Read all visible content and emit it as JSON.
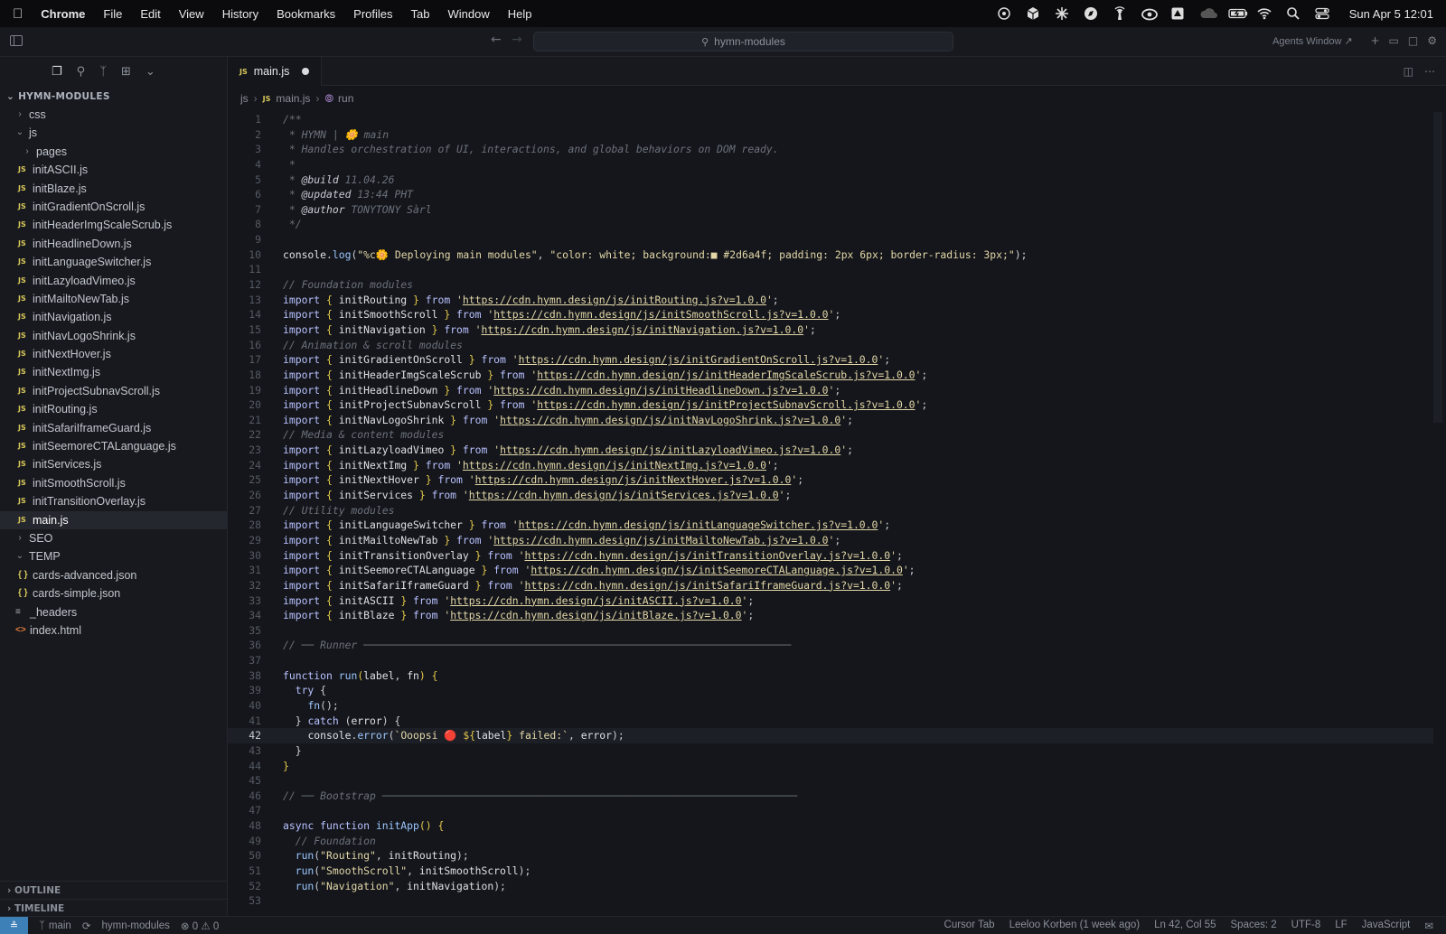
{
  "menubar": {
    "app": "Chrome",
    "items": [
      "File",
      "Edit",
      "View",
      "History",
      "Bookmarks",
      "Profiles",
      "Tab",
      "Window",
      "Help"
    ],
    "clock": "Sun Apr 5  12:01"
  },
  "titlebar": {
    "search_text": "hymn-modules",
    "agents_label": "Agents Window ↗"
  },
  "sidebar": {
    "root": "HYMN-MODULES",
    "tree": [
      {
        "label": "css",
        "kind": "folder",
        "open": false,
        "depth": 0
      },
      {
        "label": "js",
        "kind": "folder",
        "open": true,
        "depth": 0
      },
      {
        "label": "pages",
        "kind": "folder",
        "open": false,
        "depth": 1
      },
      {
        "label": "initASCII.js",
        "kind": "js",
        "depth": 1
      },
      {
        "label": "initBlaze.js",
        "kind": "js",
        "depth": 1
      },
      {
        "label": "initGradientOnScroll.js",
        "kind": "js",
        "depth": 1
      },
      {
        "label": "initHeaderImgScaleScrub.js",
        "kind": "js",
        "depth": 1
      },
      {
        "label": "initHeadlineDown.js",
        "kind": "js",
        "depth": 1
      },
      {
        "label": "initLanguageSwitcher.js",
        "kind": "js",
        "depth": 1
      },
      {
        "label": "initLazyloadVimeo.js",
        "kind": "js",
        "depth": 1
      },
      {
        "label": "initMailtoNewTab.js",
        "kind": "js",
        "depth": 1
      },
      {
        "label": "initNavigation.js",
        "kind": "js",
        "depth": 1
      },
      {
        "label": "initNavLogoShrink.js",
        "kind": "js",
        "depth": 1
      },
      {
        "label": "initNextHover.js",
        "kind": "js",
        "depth": 1
      },
      {
        "label": "initNextImg.js",
        "kind": "js",
        "depth": 1
      },
      {
        "label": "initProjectSubnavScroll.js",
        "kind": "js",
        "depth": 1
      },
      {
        "label": "initRouting.js",
        "kind": "js",
        "depth": 1
      },
      {
        "label": "initSafariIframeGuard.js",
        "kind": "js",
        "depth": 1
      },
      {
        "label": "initSeemoreCTALanguage.js",
        "kind": "js",
        "depth": 1
      },
      {
        "label": "initServices.js",
        "kind": "js",
        "depth": 1
      },
      {
        "label": "initSmoothScroll.js",
        "kind": "js",
        "depth": 1
      },
      {
        "label": "initTransitionOverlay.js",
        "kind": "js",
        "depth": 1
      },
      {
        "label": "main.js",
        "kind": "js",
        "depth": 1,
        "active": true
      },
      {
        "label": "SEO",
        "kind": "folder",
        "open": false,
        "depth": 0
      },
      {
        "label": "TEMP",
        "kind": "folder",
        "open": true,
        "depth": 0
      },
      {
        "label": "cards-advanced.json",
        "kind": "json",
        "depth": 1
      },
      {
        "label": "cards-simple.json",
        "kind": "json",
        "depth": 1
      },
      {
        "label": "_headers",
        "kind": "list",
        "depth": 0
      },
      {
        "label": "index.html",
        "kind": "html",
        "depth": 0
      }
    ],
    "outline": "OUTLINE",
    "timeline": "TIMELINE"
  },
  "tab": {
    "label": "main.js",
    "badge": "JS"
  },
  "breadcrumb": {
    "folder": "js",
    "file": "main.js",
    "symbol": "run"
  },
  "code": {
    "current_line": 42,
    "lines": [
      [
        [
          "c",
          "/**"
        ]
      ],
      [
        [
          "c",
          " * HYMN | 🌼 main"
        ]
      ],
      [
        [
          "c",
          " * Handles orchestration of UI, interactions, and global behaviors on DOM ready."
        ]
      ],
      [
        [
          "c",
          " *"
        ]
      ],
      [
        [
          "c",
          " * "
        ],
        [
          "tag",
          "@build"
        ],
        [
          "c",
          " 11.04.26"
        ]
      ],
      [
        [
          "c",
          " * "
        ],
        [
          "tag",
          "@updated"
        ],
        [
          "c",
          " 13:44 PHT"
        ]
      ],
      [
        [
          "c",
          " * "
        ],
        [
          "tag",
          "@author"
        ],
        [
          "c",
          " TONYTONY Sàrl"
        ]
      ],
      [
        [
          "c",
          " */"
        ]
      ],
      [],
      [
        [
          "v",
          "console"
        ],
        [
          "p",
          "."
        ],
        [
          "f",
          "log"
        ],
        [
          "p",
          "("
        ],
        [
          "s",
          "\"%c🌼 Deploying main modules\""
        ],
        [
          "p",
          ", "
        ],
        [
          "s",
          "\"color: white; background:■ #2d6a4f; padding: 2px 6px; border-radius: 3px;\""
        ],
        [
          "p",
          ");"
        ]
      ],
      [],
      [
        [
          "c",
          "// Foundation modules"
        ]
      ],
      [
        [
          "k",
          "import"
        ],
        [
          "b",
          " { "
        ],
        [
          "v",
          "initRouting"
        ],
        [
          "b",
          " } "
        ],
        [
          "k",
          "from"
        ],
        [
          "s",
          " '"
        ],
        [
          "u",
          "https://cdn.hymn.design/js/initRouting.js?v=1.0.0"
        ],
        [
          "s",
          "'"
        ],
        [
          "p",
          ";"
        ]
      ],
      [
        [
          "k",
          "import"
        ],
        [
          "b",
          " { "
        ],
        [
          "v",
          "initSmoothScroll"
        ],
        [
          "b",
          " } "
        ],
        [
          "k",
          "from"
        ],
        [
          "s",
          " '"
        ],
        [
          "u",
          "https://cdn.hymn.design/js/initSmoothScroll.js?v=1.0.0"
        ],
        [
          "s",
          "'"
        ],
        [
          "p",
          ";"
        ]
      ],
      [
        [
          "k",
          "import"
        ],
        [
          "b",
          " { "
        ],
        [
          "v",
          "initNavigation"
        ],
        [
          "b",
          " } "
        ],
        [
          "k",
          "from"
        ],
        [
          "s",
          " '"
        ],
        [
          "u",
          "https://cdn.hymn.design/js/initNavigation.js?v=1.0.0"
        ],
        [
          "s",
          "'"
        ],
        [
          "p",
          ";"
        ]
      ],
      [
        [
          "c",
          "// Animation & scroll modules"
        ]
      ],
      [
        [
          "k",
          "import"
        ],
        [
          "b",
          " { "
        ],
        [
          "v",
          "initGradientOnScroll"
        ],
        [
          "b",
          " } "
        ],
        [
          "k",
          "from"
        ],
        [
          "s",
          " '"
        ],
        [
          "u",
          "https://cdn.hymn.design/js/initGradientOnScroll.js?v=1.0.0"
        ],
        [
          "s",
          "'"
        ],
        [
          "p",
          ";"
        ]
      ],
      [
        [
          "k",
          "import"
        ],
        [
          "b",
          " { "
        ],
        [
          "v",
          "initHeaderImgScaleScrub"
        ],
        [
          "b",
          " } "
        ],
        [
          "k",
          "from"
        ],
        [
          "s",
          " '"
        ],
        [
          "u",
          "https://cdn.hymn.design/js/initHeaderImgScaleScrub.js?v=1.0.0"
        ],
        [
          "s",
          "'"
        ],
        [
          "p",
          ";"
        ]
      ],
      [
        [
          "k",
          "import"
        ],
        [
          "b",
          " { "
        ],
        [
          "v",
          "initHeadlineDown"
        ],
        [
          "b",
          " } "
        ],
        [
          "k",
          "from"
        ],
        [
          "s",
          " '"
        ],
        [
          "u",
          "https://cdn.hymn.design/js/initHeadlineDown.js?v=1.0.0"
        ],
        [
          "s",
          "'"
        ],
        [
          "p",
          ";"
        ]
      ],
      [
        [
          "k",
          "import"
        ],
        [
          "b",
          " { "
        ],
        [
          "v",
          "initProjectSubnavScroll"
        ],
        [
          "b",
          " } "
        ],
        [
          "k",
          "from"
        ],
        [
          "s",
          " '"
        ],
        [
          "u",
          "https://cdn.hymn.design/js/initProjectSubnavScroll.js?v=1.0.0"
        ],
        [
          "s",
          "'"
        ],
        [
          "p",
          ";"
        ]
      ],
      [
        [
          "k",
          "import"
        ],
        [
          "b",
          " { "
        ],
        [
          "v",
          "initNavLogoShrink"
        ],
        [
          "b",
          " } "
        ],
        [
          "k",
          "from"
        ],
        [
          "s",
          " '"
        ],
        [
          "u",
          "https://cdn.hymn.design/js/initNavLogoShrink.js?v=1.0.0"
        ],
        [
          "s",
          "'"
        ],
        [
          "p",
          ";"
        ]
      ],
      [
        [
          "c",
          "// Media & content modules"
        ]
      ],
      [
        [
          "k",
          "import"
        ],
        [
          "b",
          " { "
        ],
        [
          "v",
          "initLazyloadVimeo"
        ],
        [
          "b",
          " } "
        ],
        [
          "k",
          "from"
        ],
        [
          "s",
          " '"
        ],
        [
          "u",
          "https://cdn.hymn.design/js/initLazyloadVimeo.js?v=1.0.0"
        ],
        [
          "s",
          "'"
        ],
        [
          "p",
          ";"
        ]
      ],
      [
        [
          "k",
          "import"
        ],
        [
          "b",
          " { "
        ],
        [
          "v",
          "initNextImg"
        ],
        [
          "b",
          " } "
        ],
        [
          "k",
          "from"
        ],
        [
          "s",
          " '"
        ],
        [
          "u",
          "https://cdn.hymn.design/js/initNextImg.js?v=1.0.0"
        ],
        [
          "s",
          "'"
        ],
        [
          "p",
          ";"
        ]
      ],
      [
        [
          "k",
          "import"
        ],
        [
          "b",
          " { "
        ],
        [
          "v",
          "initNextHover"
        ],
        [
          "b",
          " } "
        ],
        [
          "k",
          "from"
        ],
        [
          "s",
          " '"
        ],
        [
          "u",
          "https://cdn.hymn.design/js/initNextHover.js?v=1.0.0"
        ],
        [
          "s",
          "'"
        ],
        [
          "p",
          ";"
        ]
      ],
      [
        [
          "k",
          "import"
        ],
        [
          "b",
          " { "
        ],
        [
          "v",
          "initServices"
        ],
        [
          "b",
          " } "
        ],
        [
          "k",
          "from"
        ],
        [
          "s",
          " '"
        ],
        [
          "u",
          "https://cdn.hymn.design/js/initServices.js?v=1.0.0"
        ],
        [
          "s",
          "'"
        ],
        [
          "p",
          ";"
        ]
      ],
      [
        [
          "c",
          "// Utility modules"
        ]
      ],
      [
        [
          "k",
          "import"
        ],
        [
          "b",
          " { "
        ],
        [
          "v",
          "initLanguageSwitcher"
        ],
        [
          "b",
          " } "
        ],
        [
          "k",
          "from"
        ],
        [
          "s",
          " '"
        ],
        [
          "u",
          "https://cdn.hymn.design/js/initLanguageSwitcher.js?v=1.0.0"
        ],
        [
          "s",
          "'"
        ],
        [
          "p",
          ";"
        ]
      ],
      [
        [
          "k",
          "import"
        ],
        [
          "b",
          " { "
        ],
        [
          "v",
          "initMailtoNewTab"
        ],
        [
          "b",
          " } "
        ],
        [
          "k",
          "from"
        ],
        [
          "s",
          " '"
        ],
        [
          "u",
          "https://cdn.hymn.design/js/initMailtoNewTab.js?v=1.0.0"
        ],
        [
          "s",
          "'"
        ],
        [
          "p",
          ";"
        ]
      ],
      [
        [
          "k",
          "import"
        ],
        [
          "b",
          " { "
        ],
        [
          "v",
          "initTransitionOverlay"
        ],
        [
          "b",
          " } "
        ],
        [
          "k",
          "from"
        ],
        [
          "s",
          " '"
        ],
        [
          "u",
          "https://cdn.hymn.design/js/initTransitionOverlay.js?v=1.0.0"
        ],
        [
          "s",
          "'"
        ],
        [
          "p",
          ";"
        ]
      ],
      [
        [
          "k",
          "import"
        ],
        [
          "b",
          " { "
        ],
        [
          "v",
          "initSeemoreCTALanguage"
        ],
        [
          "b",
          " } "
        ],
        [
          "k",
          "from"
        ],
        [
          "s",
          " '"
        ],
        [
          "u",
          "https://cdn.hymn.design/js/initSeemoreCTALanguage.js?v=1.0.0"
        ],
        [
          "s",
          "'"
        ],
        [
          "p",
          ";"
        ]
      ],
      [
        [
          "k",
          "import"
        ],
        [
          "b",
          " { "
        ],
        [
          "v",
          "initSafariIframeGuard"
        ],
        [
          "b",
          " } "
        ],
        [
          "k",
          "from"
        ],
        [
          "s",
          " '"
        ],
        [
          "u",
          "https://cdn.hymn.design/js/initSafariIframeGuard.js?v=1.0.0"
        ],
        [
          "s",
          "'"
        ],
        [
          "p",
          ";"
        ]
      ],
      [
        [
          "k",
          "import"
        ],
        [
          "b",
          " { "
        ],
        [
          "v",
          "initASCII"
        ],
        [
          "b",
          " } "
        ],
        [
          "k",
          "from"
        ],
        [
          "s",
          " '"
        ],
        [
          "u",
          "https://cdn.hymn.design/js/initASCII.js?v=1.0.0"
        ],
        [
          "s",
          "'"
        ],
        [
          "p",
          ";"
        ]
      ],
      [
        [
          "k",
          "import"
        ],
        [
          "b",
          " { "
        ],
        [
          "v",
          "initBlaze"
        ],
        [
          "b",
          " } "
        ],
        [
          "k",
          "from"
        ],
        [
          "s",
          " '"
        ],
        [
          "u",
          "https://cdn.hymn.design/js/initBlaze.js?v=1.0.0"
        ],
        [
          "s",
          "'"
        ],
        [
          "p",
          ";"
        ]
      ],
      [],
      [
        [
          "c",
          "// ── Runner ─────────────────────────────────────────────────────────────────────"
        ]
      ],
      [],
      [
        [
          "k",
          "function"
        ],
        [
          "p",
          " "
        ],
        [
          "f",
          "run"
        ],
        [
          "b",
          "("
        ],
        [
          "v",
          "label"
        ],
        [
          "p",
          ", "
        ],
        [
          "v",
          "fn"
        ],
        [
          "b",
          ") {"
        ]
      ],
      [
        [
          "p",
          "  "
        ],
        [
          "k",
          "try"
        ],
        [
          "p",
          " {"
        ]
      ],
      [
        [
          "p",
          "    "
        ],
        [
          "f",
          "fn"
        ],
        [
          "p",
          "();"
        ]
      ],
      [
        [
          "p",
          "  } "
        ],
        [
          "k",
          "catch"
        ],
        [
          "p",
          " ("
        ],
        [
          "v",
          "error"
        ],
        [
          "p",
          ") {"
        ]
      ],
      [
        [
          "p",
          "    "
        ],
        [
          "v",
          "console"
        ],
        [
          "p",
          "."
        ],
        [
          "f",
          "error"
        ],
        [
          "p",
          "("
        ],
        [
          "s",
          "`Ooopsi 🔴 "
        ],
        [
          "b",
          "${"
        ],
        [
          "v",
          "label"
        ],
        [
          "b",
          "}"
        ],
        [
          "s",
          " failed:`"
        ],
        [
          "p",
          ", "
        ],
        [
          "v",
          "error"
        ],
        [
          "p",
          ");"
        ]
      ],
      [
        [
          "p",
          "  }"
        ]
      ],
      [
        [
          "b",
          "}"
        ]
      ],
      [],
      [
        [
          "c",
          "// ── Bootstrap ───────────────────────────────────────────────────────────────────"
        ]
      ],
      [],
      [
        [
          "k",
          "async function"
        ],
        [
          "p",
          " "
        ],
        [
          "f",
          "initApp"
        ],
        [
          "b",
          "() {"
        ]
      ],
      [
        [
          "c",
          "  // Foundation"
        ]
      ],
      [
        [
          "p",
          "  "
        ],
        [
          "f",
          "run"
        ],
        [
          "p",
          "("
        ],
        [
          "s",
          "\"Routing\""
        ],
        [
          "p",
          ", "
        ],
        [
          "v",
          "initRouting"
        ],
        [
          "p",
          ");"
        ]
      ],
      [
        [
          "p",
          "  "
        ],
        [
          "f",
          "run"
        ],
        [
          "p",
          "("
        ],
        [
          "s",
          "\"SmoothScroll\""
        ],
        [
          "p",
          ", "
        ],
        [
          "v",
          "initSmoothScroll"
        ],
        [
          "p",
          ");"
        ]
      ],
      [
        [
          "p",
          "  "
        ],
        [
          "f",
          "run"
        ],
        [
          "p",
          "("
        ],
        [
          "s",
          "\"Navigation\""
        ],
        [
          "p",
          ", "
        ],
        [
          "v",
          "initNavigation"
        ],
        [
          "p",
          ");"
        ]
      ],
      []
    ]
  },
  "statusbar": {
    "branch": "main",
    "repo": "hymn-modules",
    "problems": "⊗ 0 ⚠ 0",
    "cursor_tab": "Cursor Tab",
    "blame": "Leeloo Korben (1 week ago)",
    "position": "Ln 42, Col 55",
    "spaces": "Spaces: 2",
    "encoding": "UTF-8",
    "eol": "LF",
    "language": "JavaScript"
  }
}
